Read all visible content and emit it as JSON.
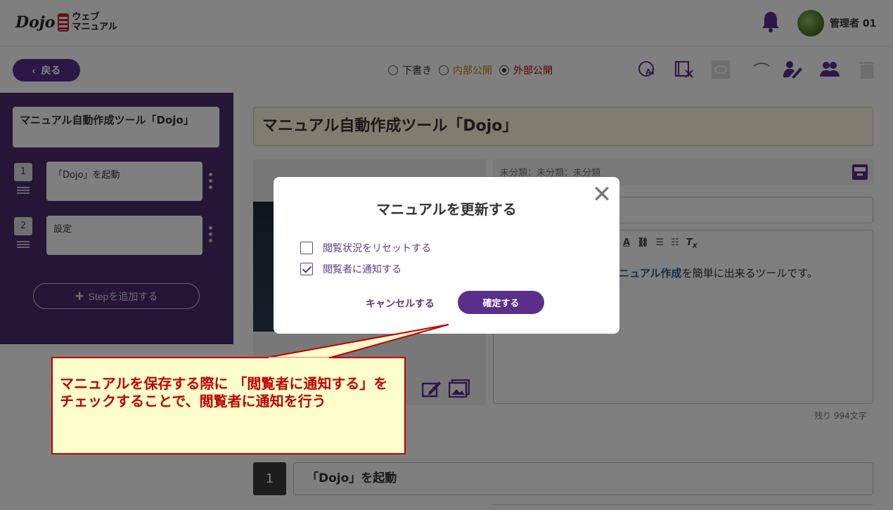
{
  "header": {
    "logo_brand": "Dojo",
    "logo_line1": "ウェブ",
    "logo_line2": "マニュアル",
    "username": "管理者 01"
  },
  "toolbar": {
    "back_label": "戻る",
    "status_options": [
      {
        "label": "下書き",
        "color": "#333333",
        "selected": false
      },
      {
        "label": "内部公開",
        "color": "#b8860b",
        "selected": false
      },
      {
        "label": "外部公開",
        "color": "#c00000",
        "selected": true
      }
    ],
    "icons": [
      "ai-icon",
      "video-tool-icon",
      "preview-icon",
      "loading-icon",
      "edit-user-icon",
      "group-icon",
      "trash-icon"
    ]
  },
  "sidebar": {
    "title": "マニュアル自動作成ツール「Dojo」",
    "steps": [
      {
        "number": "1",
        "label": "「Dojo」を起動"
      },
      {
        "number": "2",
        "label": "設定"
      }
    ],
    "add_step_label": "Stepを追加する"
  },
  "main": {
    "title": "マニュアル自動作成ツール「Dojo」",
    "category": "未分類：未分類：未分類",
    "editor_text_link": "ニュアル作成",
    "editor_text_rest": "を簡単に出来るツールです。",
    "remaining": "残り 994文字",
    "bottom_step_number": "1",
    "bottom_step_label": "「Dojo」を起動"
  },
  "modal": {
    "title": "マニュアルを更新する",
    "options": [
      {
        "label": "閲覧状況をリセットする",
        "checked": false
      },
      {
        "label": "閲覧者に通知する",
        "checked": true
      }
    ],
    "cancel_label": "キャンセルする",
    "confirm_label": "確定する"
  },
  "callout": {
    "text": "マニュアルを保存する際に 「閲覧者に通知する」をチェックすることで、閲覧者に通知を行う"
  },
  "colors": {
    "brand_purple": "#5b2e8c",
    "callout_red": "#c00000",
    "callout_bg": "#ffffcc"
  }
}
